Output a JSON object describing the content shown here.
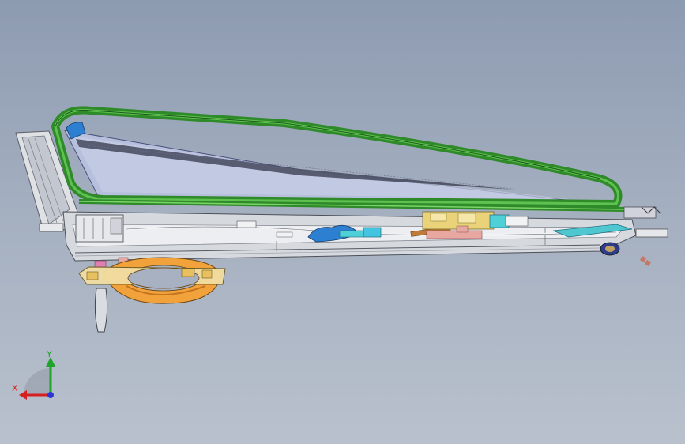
{
  "triad": {
    "x_label": "X",
    "y_label": "Y",
    "x_color": "#d62020",
    "y_color": "#1ea32b",
    "z_color": "#2b35d6"
  },
  "colors": {
    "background_top": "#8d9bb1",
    "background_bottom": "#b9c1cd",
    "seal": "#2f8a2a",
    "glass": "#b6bfdc",
    "frame": "#d6d9de",
    "rail": "#c9ccd3",
    "cassette": "#f2a23b",
    "yellow_bracket": "#e9d27a",
    "motor_blue": "#2d7fd2",
    "pink_pad": "#e9a7a2"
  }
}
